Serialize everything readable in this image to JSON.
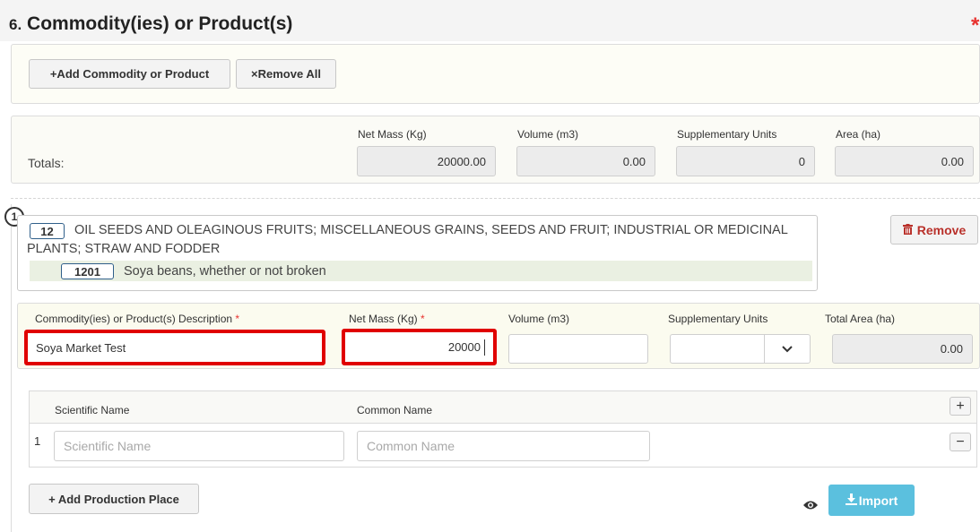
{
  "section": {
    "number": "6.",
    "title": "Commodity(ies) or Product(s)",
    "required_mark": "*"
  },
  "toolbar": {
    "add_label": "+Add Commodity or Product",
    "remove_all_label": "×Remove All"
  },
  "totals": {
    "label": "Totals:",
    "headers": {
      "net_mass": "Net Mass (Kg)",
      "volume": "Volume (m3)",
      "supplementary": "Supplementary Units",
      "area": "Area (ha)"
    },
    "values": {
      "net_mass": "20000.00",
      "volume": "0.00",
      "supplementary": "0",
      "area": "0.00"
    }
  },
  "item": {
    "index": "1",
    "chapter_code": "12",
    "chapter_text": "OIL SEEDS AND OLEAGINOUS FRUITS; MISCELLANEOUS GRAINS, SEEDS AND FRUIT; INDUSTRIAL OR MEDICINAL PLANTS; STRAW AND FODDER",
    "heading_code": "1201",
    "heading_text": "Soya beans, whether or not broken",
    "remove_label": "Remove",
    "fields": {
      "description_label": "Commodity(ies) or Product(s) Description",
      "description_value": "Soya Market Test",
      "net_mass_label": "Net Mass (Kg)",
      "net_mass_value": "20000",
      "volume_label": "Volume (m3)",
      "volume_value": "",
      "supplementary_label": "Supplementary Units",
      "supplementary_value": "",
      "total_area_label": "Total Area (ha)",
      "total_area_value": "0.00",
      "required_mark": "*"
    },
    "species": {
      "headers": {
        "scientific": "Scientific Name",
        "common": "Common Name"
      },
      "rows": [
        {
          "index": "1",
          "scientific_placeholder": "Scientific Name",
          "common_placeholder": "Common Name"
        }
      ],
      "add_symbol": "+",
      "remove_symbol": "−"
    },
    "add_production_place_label": "+ Add Production Place",
    "import_label": "Import"
  }
}
